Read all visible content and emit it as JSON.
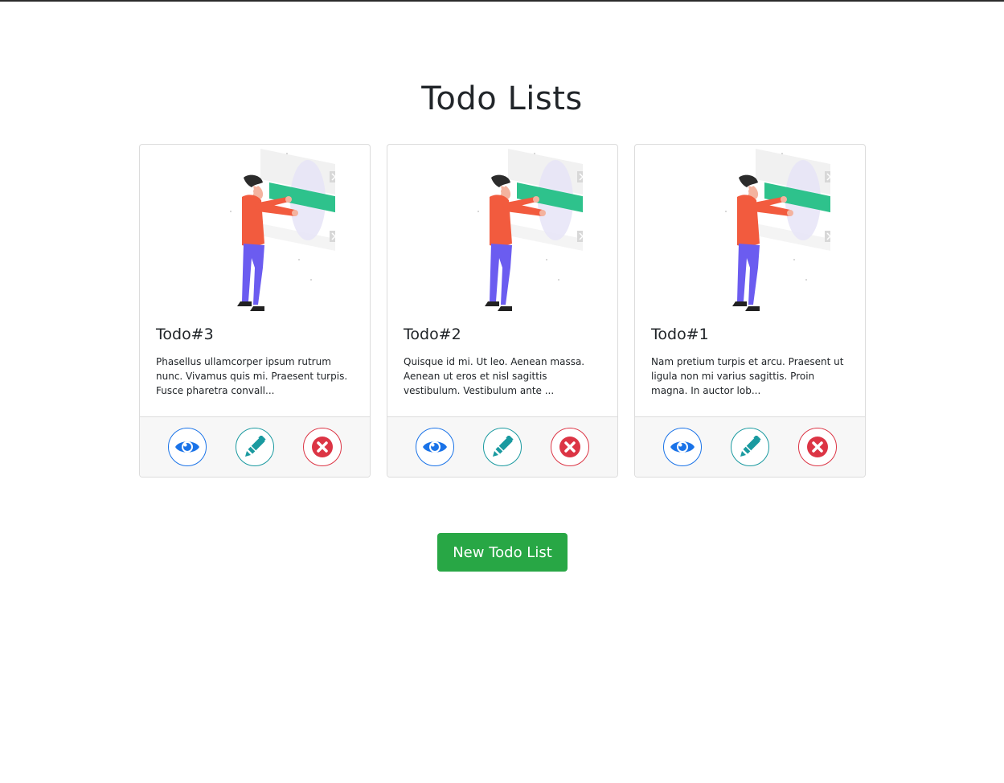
{
  "header": {
    "title": "Todo Lists"
  },
  "cards": [
    {
      "title": "Todo#3",
      "text": "Phasellus ullamcorper ipsum rutrum nunc. Vivamus quis mi. Praesent turpis. Fusce pharetra convall..."
    },
    {
      "title": "Todo#2",
      "text": "Quisque id mi. Ut leo. Aenean massa. Aenean ut eros et nisl sagittis vestibulum. Vestibulum ante ..."
    },
    {
      "title": "Todo#1",
      "text": "Nam pretium turpis et arcu. Praesent ut ligula non mi varius sagittis. Proin magna. In auctor lob..."
    }
  ],
  "actions": {
    "view_icon": "eye-icon",
    "edit_icon": "pencil-icon",
    "delete_icon": "x-circle-icon"
  },
  "new_button": {
    "label": "New Todo List"
  },
  "colors": {
    "view": "#1a73e8",
    "edit": "#1a9aa0",
    "delete": "#dc3545",
    "new_button": "#28a745",
    "illustration_accent": "#2ec28c"
  }
}
